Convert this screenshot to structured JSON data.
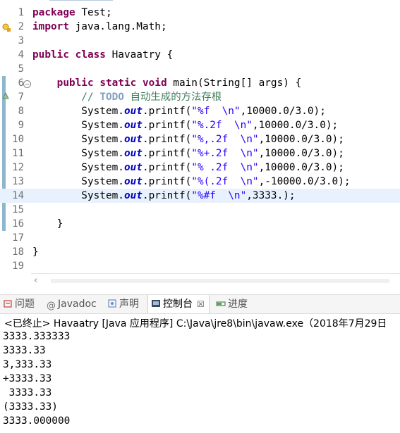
{
  "editor": {
    "lines": [
      {
        "n": "1",
        "tokens": [
          {
            "t": "package",
            "c": "kw"
          },
          {
            "t": " Test;",
            "c": ""
          }
        ]
      },
      {
        "n": "2",
        "tokens": [
          {
            "t": "import",
            "c": "kw"
          },
          {
            "t": " java.lang.Math;",
            "c": ""
          }
        ]
      },
      {
        "n": "3",
        "tokens": []
      },
      {
        "n": "4",
        "tokens": [
          {
            "t": "public",
            "c": "kw"
          },
          {
            "t": " ",
            "c": ""
          },
          {
            "t": "class",
            "c": "kw"
          },
          {
            "t": " Havaatry {",
            "c": ""
          }
        ]
      },
      {
        "n": "5",
        "tokens": []
      },
      {
        "n": "6",
        "tokens": [
          {
            "t": "    ",
            "c": ""
          },
          {
            "t": "public",
            "c": "kw"
          },
          {
            "t": " ",
            "c": ""
          },
          {
            "t": "static",
            "c": "kw"
          },
          {
            "t": " ",
            "c": ""
          },
          {
            "t": "void",
            "c": "kw"
          },
          {
            "t": " main(String[] args) {",
            "c": ""
          }
        ]
      },
      {
        "n": "7",
        "tokens": [
          {
            "t": "        // ",
            "c": "cmt"
          },
          {
            "t": "TODO",
            "c": "todo"
          },
          {
            "t": " 自动生成的方法存根",
            "c": "cmt"
          }
        ]
      },
      {
        "n": "8",
        "tokens": [
          {
            "t": "        System.",
            "c": ""
          },
          {
            "t": "out",
            "c": "fld"
          },
          {
            "t": ".printf(",
            "c": ""
          },
          {
            "t": "\"%f  \\n\"",
            "c": "str"
          },
          {
            "t": ",10000.0/3.0);",
            "c": ""
          }
        ]
      },
      {
        "n": "9",
        "tokens": [
          {
            "t": "        System.",
            "c": ""
          },
          {
            "t": "out",
            "c": "fld"
          },
          {
            "t": ".printf(",
            "c": ""
          },
          {
            "t": "\"%.2f  \\n\"",
            "c": "str"
          },
          {
            "t": ",10000.0/3.0);",
            "c": ""
          }
        ]
      },
      {
        "n": "10",
        "tokens": [
          {
            "t": "        System.",
            "c": ""
          },
          {
            "t": "out",
            "c": "fld"
          },
          {
            "t": ".printf(",
            "c": ""
          },
          {
            "t": "\"%,.2f  \\n\"",
            "c": "str"
          },
          {
            "t": ",10000.0/3.0);",
            "c": ""
          }
        ]
      },
      {
        "n": "11",
        "tokens": [
          {
            "t": "        System.",
            "c": ""
          },
          {
            "t": "out",
            "c": "fld"
          },
          {
            "t": ".printf(",
            "c": ""
          },
          {
            "t": "\"%+.2f  \\n\"",
            "c": "str"
          },
          {
            "t": ",10000.0/3.0);",
            "c": ""
          }
        ]
      },
      {
        "n": "12",
        "tokens": [
          {
            "t": "        System.",
            "c": ""
          },
          {
            "t": "out",
            "c": "fld"
          },
          {
            "t": ".printf(",
            "c": ""
          },
          {
            "t": "\"% .2f  \\n\"",
            "c": "str"
          },
          {
            "t": ",10000.0/3.0);",
            "c": ""
          }
        ]
      },
      {
        "n": "13",
        "tokens": [
          {
            "t": "        System.",
            "c": ""
          },
          {
            "t": "out",
            "c": "fld"
          },
          {
            "t": ".printf(",
            "c": ""
          },
          {
            "t": "\"%(.2f  \\n\"",
            "c": "str"
          },
          {
            "t": ",-10000.0/3.0);",
            "c": ""
          }
        ]
      },
      {
        "n": "14",
        "tokens": [
          {
            "t": "        System.",
            "c": ""
          },
          {
            "t": "out",
            "c": "fld"
          },
          {
            "t": ".printf(",
            "c": ""
          },
          {
            "t": "\"%#f  \\n\"",
            "c": "str"
          },
          {
            "t": ",3333.);",
            "c": ""
          }
        ]
      },
      {
        "n": "15",
        "tokens": []
      },
      {
        "n": "16",
        "tokens": [
          {
            "t": "    }",
            "c": ""
          }
        ]
      },
      {
        "n": "17",
        "tokens": []
      },
      {
        "n": "18",
        "tokens": [
          {
            "t": "}",
            "c": ""
          }
        ]
      },
      {
        "n": "19",
        "tokens": []
      }
    ]
  },
  "tabs": [
    {
      "label": "问题",
      "icon": "problems-icon"
    },
    {
      "label": "Javadoc",
      "icon": "at-icon"
    },
    {
      "label": "声明",
      "icon": "declaration-icon"
    },
    {
      "label": "控制台",
      "icon": "console-icon",
      "close": "☒"
    },
    {
      "label": "进度",
      "icon": "progress-icon"
    }
  ],
  "console": {
    "header": "<已终止> Havaatry [Java 应用程序] C:\\Java\\jre8\\bin\\javaw.exe（2018年7月29日",
    "lines": [
      "3333.333333",
      "3333.33",
      "3,333.33",
      "+3333.33",
      " 3333.33",
      "(3333.33)",
      "3333.000000"
    ]
  },
  "colors": {
    "keyword": "#7f0055",
    "string": "#2a00ff",
    "field": "#0000c0",
    "comment": "#3f7f5f",
    "current_line": "#e8f2fe"
  }
}
